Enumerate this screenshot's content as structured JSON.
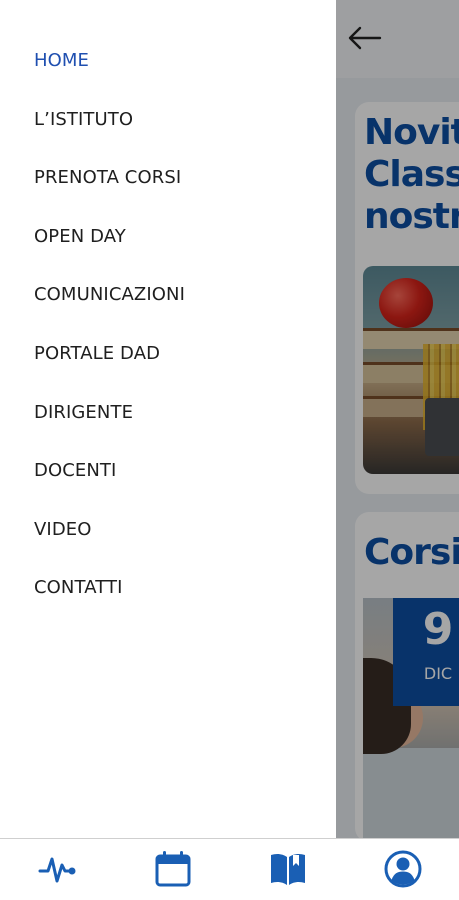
{
  "menu": {
    "items": [
      {
        "label": "HOME",
        "active": true
      },
      {
        "label": "L’ISTITUTO",
        "active": false
      },
      {
        "label": "PRENOTA CORSI",
        "active": false
      },
      {
        "label": "OPEN DAY",
        "active": false
      },
      {
        "label": "COMUNICAZIONI",
        "active": false
      },
      {
        "label": "PORTALE DAD",
        "active": false
      },
      {
        "label": "DIRIGENTE",
        "active": false
      },
      {
        "label": "DOCENTI",
        "active": false
      },
      {
        "label": "VIDEO",
        "active": false
      },
      {
        "label": "CONTATTI",
        "active": false
      }
    ]
  },
  "background": {
    "card1_title": [
      "Novit",
      "Class",
      "nostr"
    ],
    "card2_title": "Corsi",
    "date_badge": {
      "day": "9",
      "month": "DIC"
    }
  },
  "bottom_nav": [
    {
      "icon": "activity-pulse-icon"
    },
    {
      "icon": "calendar-icon"
    },
    {
      "icon": "book-icon"
    },
    {
      "icon": "user-profile-icon"
    }
  ],
  "colors": {
    "accent": "#1f4fb0",
    "brand_blue": "#0d4fa3",
    "icon_blue": "#1a5fb4",
    "menu_text": "#1f1f1f"
  }
}
